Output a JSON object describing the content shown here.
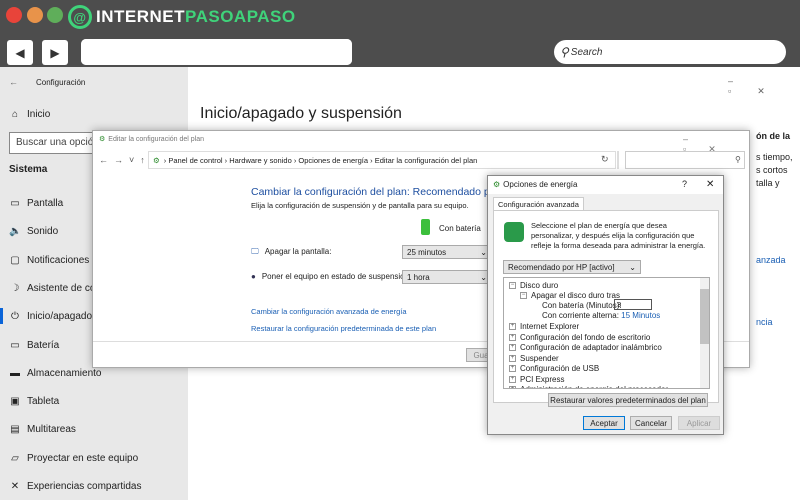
{
  "browser": {
    "brand_white": "INTERNET",
    "brand_green": "PASOAPASO",
    "search_placeholder": "Search",
    "back": "◀",
    "forward": "▶"
  },
  "settings": {
    "window_title": "Configuración",
    "home": "Inicio",
    "search_placeholder": "Buscar una opción de configuración",
    "section": "Sistema",
    "page_title": "Inicio/apagado y suspensión",
    "items": [
      {
        "icon": "display-icon",
        "label": "Pantalla"
      },
      {
        "icon": "speaker-icon",
        "label": "Sonido"
      },
      {
        "icon": "notification-icon",
        "label": "Notificaciones y acciones"
      },
      {
        "icon": "moon-icon",
        "label": "Asistente de concentración"
      },
      {
        "icon": "power-icon",
        "label": "Inicio/apagado y suspensión"
      },
      {
        "icon": "battery-icon",
        "label": "Batería"
      },
      {
        "icon": "storage-icon",
        "label": "Almacenamiento"
      },
      {
        "icon": "tablet-icon",
        "label": "Tableta"
      },
      {
        "icon": "multitask-icon",
        "label": "Multitareas"
      },
      {
        "icon": "project-icon",
        "label": "Proyectar en este equipo"
      },
      {
        "icon": "shared-icon",
        "label": "Experiencias compartidas"
      }
    ],
    "right_text": [
      "ón de la",
      "s tiempo,",
      "s cortos",
      "talla y"
    ],
    "right_links": [
      "anzada",
      "ncia"
    ]
  },
  "control_panel": {
    "title": "Editar la configuración del plan",
    "breadcrumb": [
      "Panel de control",
      "Hardware y sonido",
      "Opciones de energía",
      "Editar la configuración del plan"
    ],
    "heading": "Cambiar la configuración del plan: Recomendado por HP",
    "subheading": "Elija la configuración de suspensión y de pantalla para su equipo.",
    "battery_col": "Con batería",
    "screen_label": "Apagar la pantalla:",
    "screen_value": "25 minutos",
    "sleep_label": "Poner el equipo en estado de suspensión:",
    "sleep_value": "1 hora",
    "link_advanced": "Cambiar la configuración avanzada de energía",
    "link_restore": "Restaurar la configuración predeterminada de este plan",
    "save": "Gua"
  },
  "dialog": {
    "title": "Opciones de energía",
    "help": "?",
    "close": "✕",
    "tab": "Configuración avanzada",
    "intro": "Seleccione el plan de energía que desea personalizar, y después elija la configuración que refleje la forma deseada para administrar la energía.",
    "plan": "Recomendado por HP [activo]",
    "tree": {
      "disk": "Disco duro",
      "disk_off": "Apagar el disco duro tras",
      "battery_label": "Con batería (Minutos):",
      "battery_value": "3",
      "ac_label": "Con corriente alterna:",
      "ac_value": "15 Minutos",
      "others": [
        "Internet Explorer",
        "Configuración del fondo de escritorio",
        "Configuración de adaptador inalámbrico",
        "Suspender",
        "Configuración de USB",
        "PCI Express",
        "Administración de energía del procesador"
      ]
    },
    "restore": "Restaurar valores predeterminados del plan",
    "ok": "Aceptar",
    "cancel": "Cancelar",
    "apply": "Aplicar"
  }
}
